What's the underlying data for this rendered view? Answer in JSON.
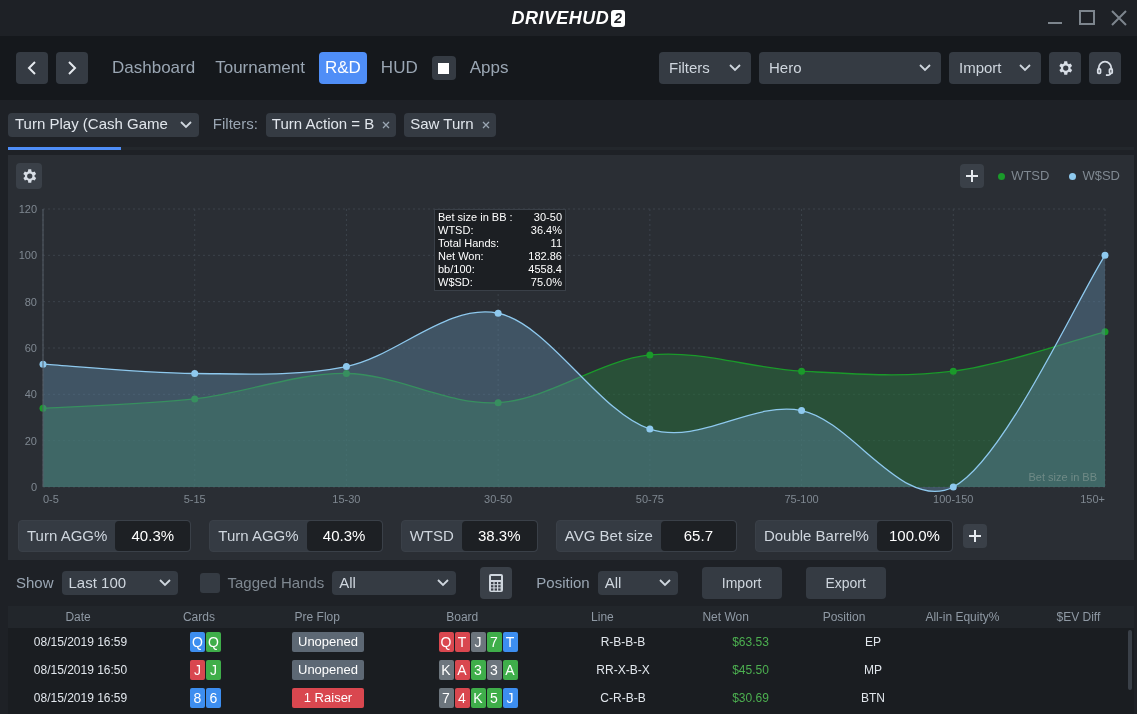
{
  "window": {
    "logo": "DRIVEHUD",
    "logo_badge": "2"
  },
  "nav": {
    "tabs": [
      {
        "label": "Dashboard",
        "selected": false
      },
      {
        "label": "Tournament",
        "selected": false
      },
      {
        "label": "R&D",
        "selected": true
      },
      {
        "label": "HUD",
        "selected": false
      }
    ],
    "hud_toggle": {
      "checked": true
    },
    "apps": "Apps",
    "filters": "Filters",
    "player": "Hero",
    "import": "Import"
  },
  "filter_bar": {
    "report": "Turn Play (Cash Game",
    "label": "Filters:",
    "chips": [
      "Turn Action = B",
      "Saw Turn"
    ],
    "progress": {
      "level": 0.1
    }
  },
  "chart": {
    "tooltip": [
      {
        "label": "Bet size in BB :",
        "value": "30-50"
      },
      {
        "label": "WTSD:",
        "value": "36.4%"
      },
      {
        "label": "Total Hands:",
        "value": "11"
      },
      {
        "label": "Net Won:",
        "value": "182.86"
      },
      {
        "label": "bb/100:",
        "value": "4558.4"
      },
      {
        "label": "W$SD:",
        "value": "75.0%"
      }
    ],
    "chart_data": {
      "type": "area",
      "grid": true,
      "xlabel": "Bet size in BB",
      "categories": [
        "0-5",
        "5-15",
        "15-30",
        "30-50",
        "50-75",
        "75-100",
        "100-150",
        "150+"
      ],
      "ylim": [
        0,
        120
      ],
      "yticks": [
        0,
        20,
        40,
        60,
        80,
        100,
        120
      ],
      "series": [
        {
          "name": "WTSD",
          "color": "#1a9a2a",
          "values": [
            34,
            38,
            49,
            36.4,
            57,
            50,
            50,
            67
          ]
        },
        {
          "name": "W$SD",
          "color": "#8ec9ee",
          "values": [
            53,
            49,
            52,
            75,
            25,
            33,
            0,
            100
          ]
        }
      ]
    }
  },
  "stats": [
    {
      "label": "Turn AGG%",
      "value": "40.3%"
    },
    {
      "label": "Turn AGG%",
      "value": "40.3%"
    },
    {
      "label": "WTSD",
      "value": "38.3%"
    },
    {
      "label": "AVG Bet size",
      "value": "65.7"
    },
    {
      "label": "Double Barrel%",
      "value": "100.0%"
    }
  ],
  "controls": {
    "show_label": "Show",
    "show": "Last 100",
    "tagged": {
      "label": "Tagged Hands",
      "checked": false
    },
    "tagged_select": "All",
    "position_label": "Position",
    "position": "All",
    "import": "Import",
    "export": "Export"
  },
  "table": {
    "columns": [
      "Date",
      "Cards",
      "Pre Flop",
      "Board",
      "Line",
      "Net Won",
      "Position",
      "All-in Equity%",
      "$EV Diff"
    ],
    "rows": [
      {
        "date": "08/15/2019 16:59",
        "cards": [
          {
            "rank": "Q",
            "color": "#3d8ef0"
          },
          {
            "rank": "Q",
            "color": "#3fae4a"
          }
        ],
        "preflop": {
          "text": "Unopened",
          "kind": "unopened"
        },
        "board": [
          {
            "rank": "Q",
            "color": "#d9474f"
          },
          {
            "rank": "T",
            "color": "#d9474f"
          },
          {
            "rank": "J",
            "color": "#6c757d"
          },
          {
            "rank": "7",
            "color": "#3fae4a"
          },
          {
            "rank": "T",
            "color": "#3d8ef0"
          }
        ],
        "line": "R-B-B-B",
        "net_won": "$63.53",
        "position": "EP"
      },
      {
        "date": "08/15/2019 16:50",
        "cards": [
          {
            "rank": "J",
            "color": "#d9474f"
          },
          {
            "rank": "J",
            "color": "#3fae4a"
          }
        ],
        "preflop": {
          "text": "Unopened",
          "kind": "unopened"
        },
        "board": [
          {
            "rank": "K",
            "color": "#6c757d"
          },
          {
            "rank": "A",
            "color": "#d9474f"
          },
          {
            "rank": "3",
            "color": "#3fae4a"
          },
          {
            "rank": "3",
            "color": "#6c757d"
          },
          {
            "rank": "A",
            "color": "#3fae4a"
          }
        ],
        "line": "RR-X-B-X",
        "net_won": "$45.50",
        "position": "MP"
      },
      {
        "date": "08/15/2019 16:59",
        "cards": [
          {
            "rank": "8",
            "color": "#3d8ef0"
          },
          {
            "rank": "6",
            "color": "#3d8ef0"
          }
        ],
        "preflop": {
          "text": "1 Raiser",
          "kind": "raiser"
        },
        "board": [
          {
            "rank": "7",
            "color": "#6c757d"
          },
          {
            "rank": "4",
            "color": "#d9474f"
          },
          {
            "rank": "K",
            "color": "#3fae4a"
          },
          {
            "rank": "5",
            "color": "#3fae4a"
          },
          {
            "rank": "J",
            "color": "#3d8ef0"
          }
        ],
        "line": "C-R-B-B",
        "net_won": "$30.69",
        "position": "BTN"
      }
    ]
  }
}
